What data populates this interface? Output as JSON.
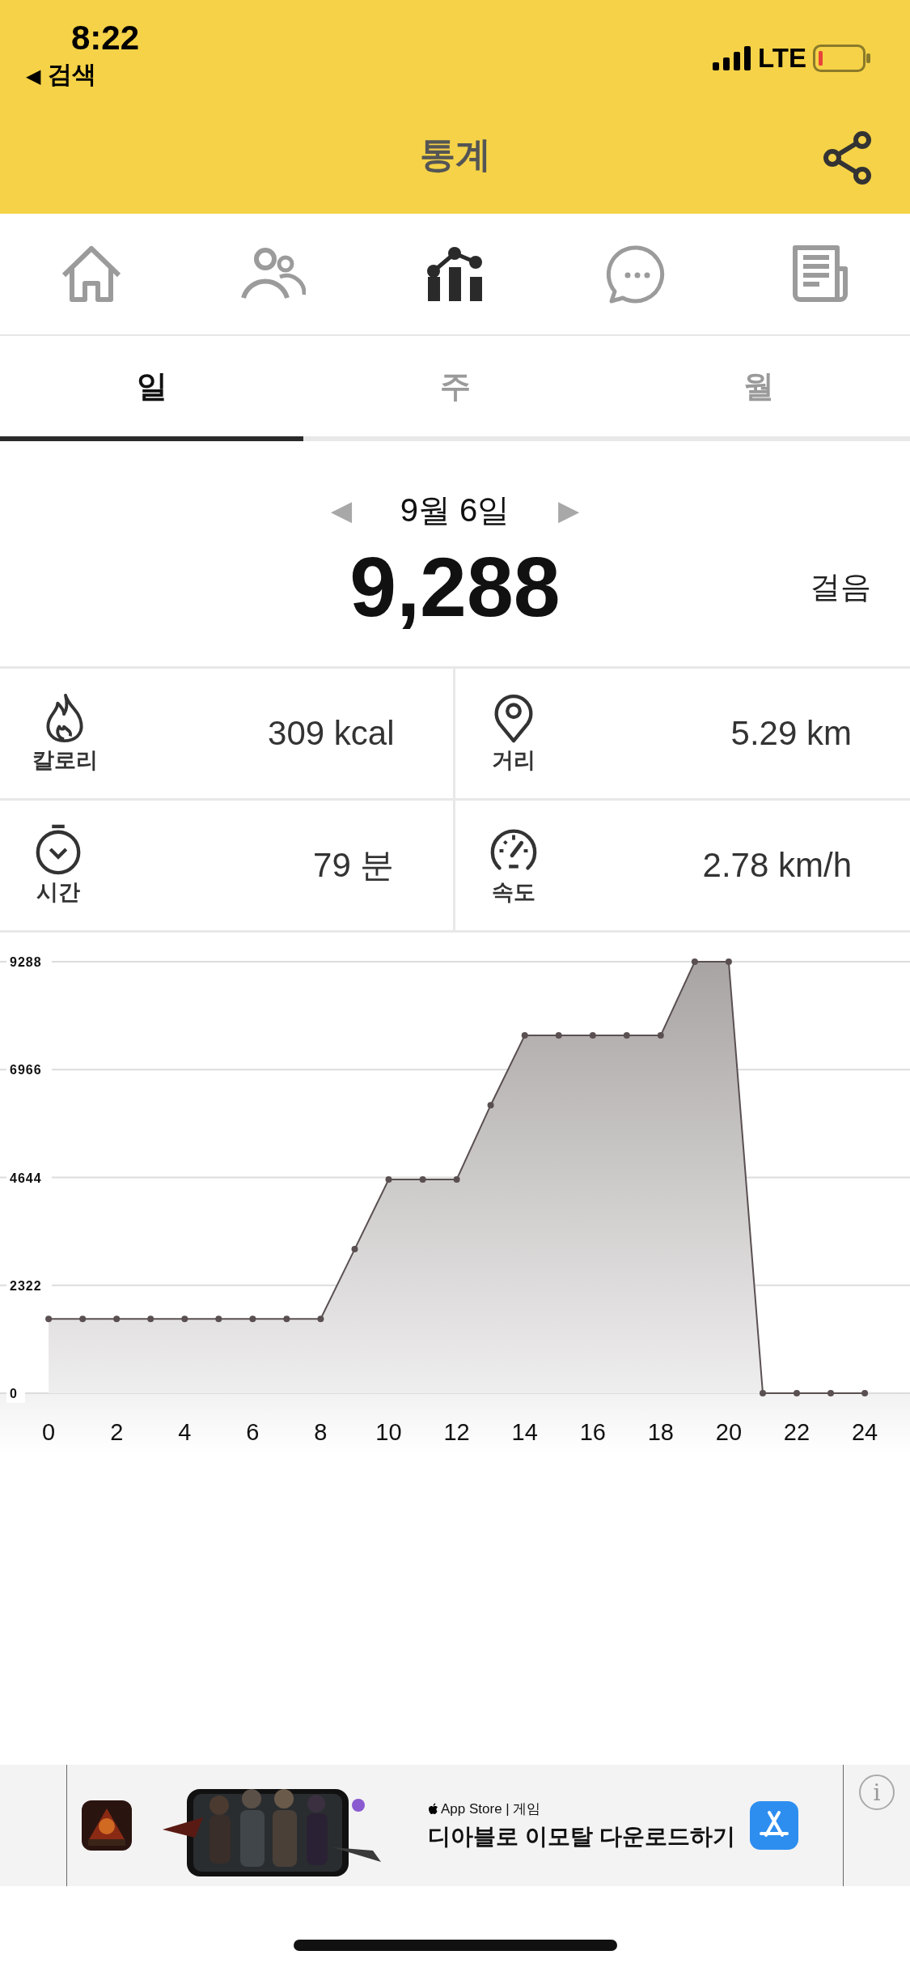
{
  "status_bar": {
    "time": "8:22",
    "back_arrow": "◀",
    "back_label": "검색",
    "network": "LTE"
  },
  "header": {
    "title": "통계"
  },
  "nav": [
    {
      "kind": "home",
      "selected": false
    },
    {
      "kind": "people",
      "selected": false
    },
    {
      "kind": "stats",
      "selected": true
    },
    {
      "kind": "chat",
      "selected": false
    },
    {
      "kind": "news",
      "selected": false
    }
  ],
  "tabs": [
    {
      "label": "일",
      "selected": true
    },
    {
      "label": "주",
      "selected": false
    },
    {
      "label": "월",
      "selected": false
    }
  ],
  "date": {
    "prev": "◀",
    "label": "9월 6일",
    "next": "▶"
  },
  "steps": {
    "value": "9,288",
    "unit": "걸음"
  },
  "stats": [
    {
      "kind": "calories",
      "label": "칼로리",
      "value": "309 kcal"
    },
    {
      "kind": "distance",
      "label": "거리",
      "value": "5.29 km"
    },
    {
      "kind": "time",
      "label": "시간",
      "value": "79 분"
    },
    {
      "kind": "speed",
      "label": "속도",
      "value": "2.78 km/h"
    }
  ],
  "chart": {
    "chart_data": {
      "type": "area",
      "x": [
        0,
        1,
        2,
        3,
        4,
        5,
        6,
        7,
        8,
        9,
        10,
        11,
        12,
        13,
        14,
        15,
        16,
        17,
        18,
        19,
        20,
        21,
        22,
        23,
        24
      ],
      "series": [
        {
          "color": "#5a5052",
          "values": [
            1600,
            1600,
            1600,
            1600,
            1600,
            1600,
            1600,
            1600,
            1600,
            3100,
            4600,
            4600,
            4600,
            6200,
            7700,
            7700,
            7700,
            7700,
            7700,
            9288,
            9288,
            0,
            0,
            0,
            0
          ]
        }
      ],
      "xlim": [
        -1.43,
        25.33
      ],
      "ylim": [
        0,
        9288
      ],
      "grid": true,
      "xticks": [
        0,
        2,
        4,
        6,
        8,
        10,
        12,
        14,
        16,
        18,
        20,
        22,
        24
      ],
      "yticks": [
        0,
        2322,
        4644,
        6966,
        9288
      ]
    }
  },
  "ad": {
    "source": "App Store | 게임",
    "headline": "디아블로 이모탈 다운로드하기",
    "info": "i"
  }
}
